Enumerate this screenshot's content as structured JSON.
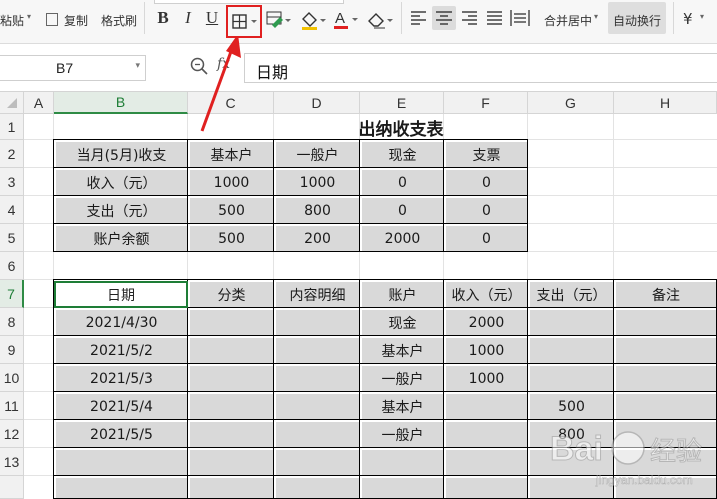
{
  "toolbar": {
    "paste_label": "粘贴",
    "copy_label": "复制",
    "format_painter_label": "格式刷",
    "bold_label": "B",
    "italic_label": "I",
    "underline_label": "U",
    "merge_center_label": "合并居中",
    "auto_wrap_label": "自动换行",
    "currency_label": "¥"
  },
  "formula_bar": {
    "name_box": "B7",
    "fx_label": "fx",
    "content": "日期"
  },
  "columns": [
    "A",
    "B",
    "C",
    "D",
    "E",
    "F",
    "G",
    "H"
  ],
  "rows": [
    "1",
    "2",
    "3",
    "4",
    "5",
    "6",
    "7",
    "8",
    "9",
    "10",
    "11",
    "12",
    "13"
  ],
  "title": "出纳收支表",
  "summary_table": {
    "headers": [
      "当月(5月)收支",
      "基本户",
      "一般户",
      "现金",
      "支票"
    ],
    "rows": [
      [
        "收入（元）",
        "1000",
        "1000",
        "0",
        "0"
      ],
      [
        "支出（元）",
        "500",
        "800",
        "0",
        "0"
      ],
      [
        "账户余额",
        "500",
        "200",
        "2000",
        "0"
      ]
    ]
  },
  "ledger_table": {
    "headers": [
      "日期",
      "分类",
      "内容明细",
      "账户",
      "收入（元）",
      "支出（元）",
      "备注"
    ],
    "rows": [
      [
        "2021/4/30",
        "",
        "",
        "现金",
        "2000",
        "",
        ""
      ],
      [
        "2021/5/2",
        "",
        "",
        "基本户",
        "1000",
        "",
        ""
      ],
      [
        "2021/5/3",
        "",
        "",
        "一般户",
        "1000",
        "",
        ""
      ],
      [
        "2021/5/4",
        "",
        "",
        "基本户",
        "",
        "500",
        ""
      ],
      [
        "2021/5/5",
        "",
        "",
        "一般户",
        "",
        "800",
        ""
      ]
    ]
  },
  "watermark": {
    "brand": "Bai",
    "brand2": "经验",
    "domain": "jingyan.baidu.com"
  },
  "colors": {
    "accent_green": "#1e7d36",
    "highlight_red": "#e02020",
    "cell_shade": "#d9d9d9"
  }
}
